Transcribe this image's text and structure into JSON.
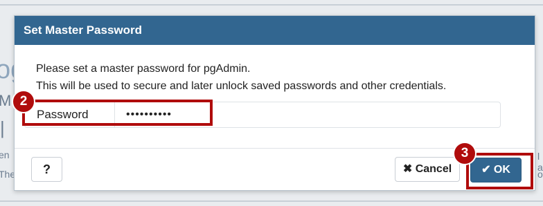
{
  "background": {
    "fragments": [
      "og",
      "Ma",
      "|",
      "en",
      "The",
      "l a",
      "o"
    ]
  },
  "dialog": {
    "title": "Set Master Password",
    "message_line1": "Please set a master password for pgAdmin.",
    "message_line2": "This will be used to secure and later unlock saved passwords and other credentials.",
    "password_label": "Password",
    "password_value": "••••••••••",
    "help_label": "?",
    "cancel_label": "Cancel",
    "ok_label": "OK",
    "cancel_icon": "close-icon",
    "ok_icon": "check-icon"
  },
  "annotations": {
    "step_password": "2",
    "step_ok": "3"
  },
  "colors": {
    "header": "#326690",
    "highlight": "#b00c0c",
    "ok_button": "#326690"
  }
}
